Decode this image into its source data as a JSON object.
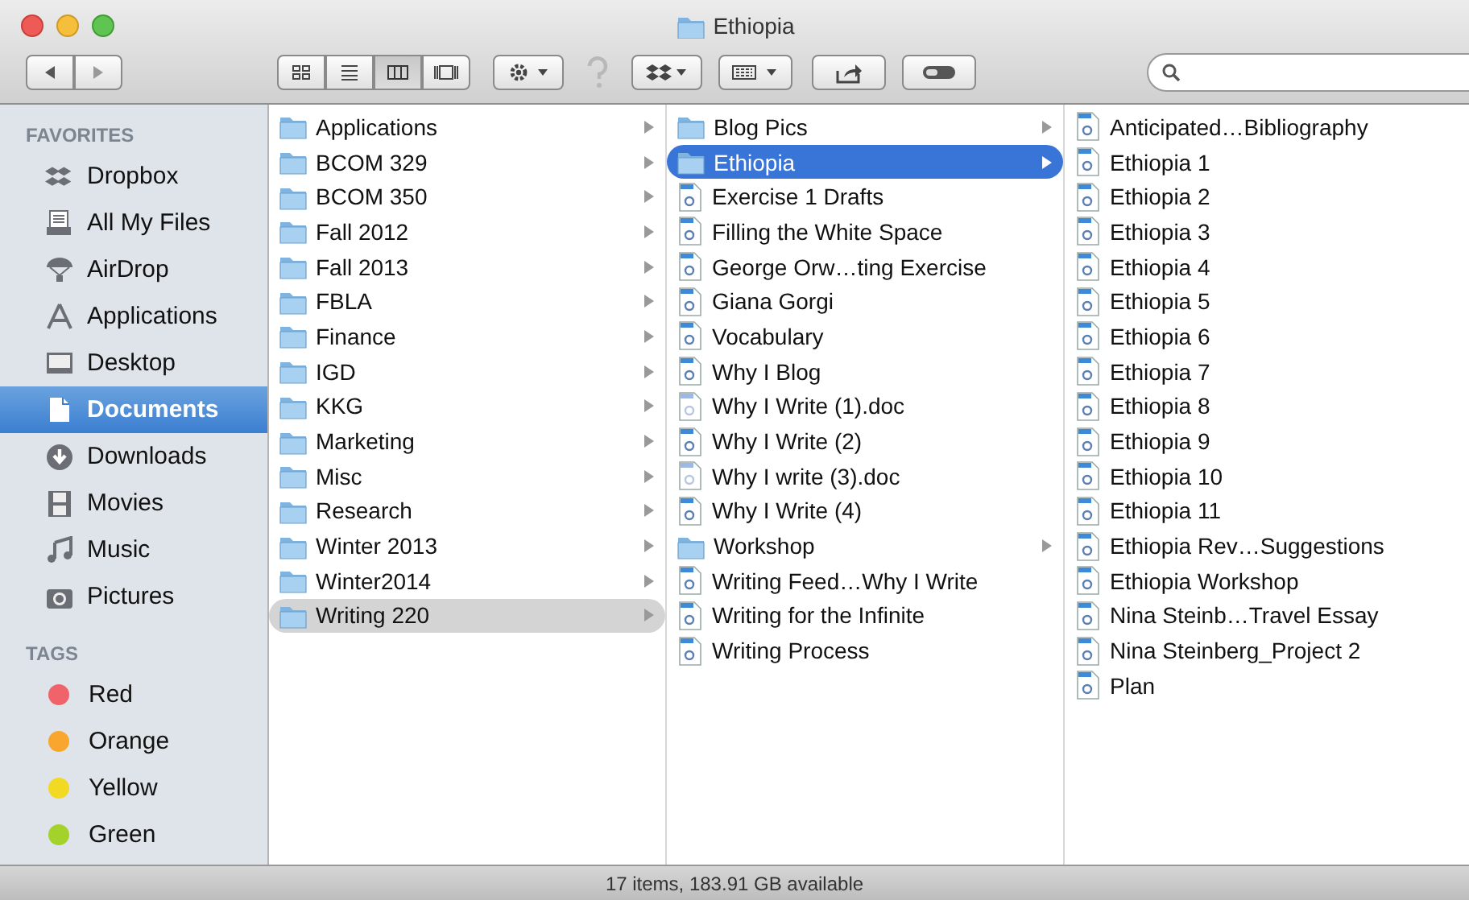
{
  "window": {
    "title": "Ethiopia"
  },
  "sidebar": {
    "sections": [
      {
        "heading": "FAVORITES",
        "items": [
          {
            "label": "Dropbox",
            "kind": "dropbox",
            "selected": false
          },
          {
            "label": "All My Files",
            "kind": "files",
            "selected": false
          },
          {
            "label": "AirDrop",
            "kind": "airdrop",
            "selected": false
          },
          {
            "label": "Applications",
            "kind": "apps",
            "selected": false
          },
          {
            "label": "Desktop",
            "kind": "desktop",
            "selected": false
          },
          {
            "label": "Documents",
            "kind": "documents",
            "selected": true
          },
          {
            "label": "Downloads",
            "kind": "downloads",
            "selected": false
          },
          {
            "label": "Movies",
            "kind": "movies",
            "selected": false
          },
          {
            "label": "Music",
            "kind": "music",
            "selected": false
          },
          {
            "label": "Pictures",
            "kind": "pictures",
            "selected": false
          }
        ]
      },
      {
        "heading": "TAGS",
        "items": [
          {
            "label": "Red",
            "kind": "tag",
            "color": "#f0636b",
            "selected": false
          },
          {
            "label": "Orange",
            "kind": "tag",
            "color": "#f9a62f",
            "selected": false
          },
          {
            "label": "Yellow",
            "kind": "tag",
            "color": "#f2d923",
            "selected": false
          },
          {
            "label": "Green",
            "kind": "tag",
            "color": "#a3d22b",
            "selected": false
          }
        ]
      }
    ]
  },
  "columns": [
    {
      "items": [
        {
          "name": "Applications",
          "kind": "folder",
          "selected": false
        },
        {
          "name": "BCOM 329",
          "kind": "folder",
          "selected": false
        },
        {
          "name": "BCOM 350",
          "kind": "folder",
          "selected": false
        },
        {
          "name": "Fall 2012",
          "kind": "folder",
          "selected": false
        },
        {
          "name": "Fall 2013",
          "kind": "folder",
          "selected": false
        },
        {
          "name": "FBLA",
          "kind": "folder",
          "selected": false
        },
        {
          "name": "Finance",
          "kind": "folder",
          "selected": false
        },
        {
          "name": "IGD",
          "kind": "folder",
          "selected": false
        },
        {
          "name": "KKG",
          "kind": "folder",
          "selected": false
        },
        {
          "name": "Marketing",
          "kind": "folder",
          "selected": false
        },
        {
          "name": "Misc",
          "kind": "folder",
          "selected": false
        },
        {
          "name": "Research",
          "kind": "folder",
          "selected": false
        },
        {
          "name": "Winter 2013",
          "kind": "folder",
          "selected": false
        },
        {
          "name": "Winter2014",
          "kind": "folder",
          "selected": false
        },
        {
          "name": "Writing 220",
          "kind": "folder",
          "selected": true,
          "focused": false
        }
      ]
    },
    {
      "items": [
        {
          "name": "Blog Pics",
          "kind": "folder",
          "selected": false
        },
        {
          "name": "Ethiopia",
          "kind": "folder",
          "selected": true,
          "focused": true
        },
        {
          "name": "Exercise 1 Drafts",
          "kind": "document",
          "selected": false
        },
        {
          "name": "Filling the White Space",
          "kind": "document",
          "selected": false
        },
        {
          "name": "George Orw…ting Exercise",
          "kind": "document",
          "selected": false
        },
        {
          "name": "Giana Gorgi",
          "kind": "document",
          "selected": false
        },
        {
          "name": "Vocabulary",
          "kind": "document",
          "selected": false
        },
        {
          "name": "Why I Blog",
          "kind": "document",
          "selected": false
        },
        {
          "name": "Why I Write (1).doc",
          "kind": "word",
          "selected": false
        },
        {
          "name": "Why I Write (2)",
          "kind": "document",
          "selected": false
        },
        {
          "name": "Why I write (3).doc",
          "kind": "word",
          "selected": false
        },
        {
          "name": "Why I Write (4)",
          "kind": "document",
          "selected": false
        },
        {
          "name": "Workshop",
          "kind": "folder",
          "selected": false
        },
        {
          "name": "Writing Feed…Why I Write",
          "kind": "document",
          "selected": false
        },
        {
          "name": "Writing for the Infinite",
          "kind": "document",
          "selected": false
        },
        {
          "name": "Writing Process",
          "kind": "document",
          "selected": false
        }
      ]
    },
    {
      "items": [
        {
          "name": "Anticipated…Bibliography",
          "kind": "document",
          "selected": false
        },
        {
          "name": "Ethiopia 1",
          "kind": "document",
          "selected": false
        },
        {
          "name": "Ethiopia 2",
          "kind": "document",
          "selected": false
        },
        {
          "name": "Ethiopia 3",
          "kind": "document",
          "selected": false
        },
        {
          "name": "Ethiopia 4",
          "kind": "document",
          "selected": false
        },
        {
          "name": "Ethiopia 5",
          "kind": "document",
          "selected": false
        },
        {
          "name": "Ethiopia 6",
          "kind": "document",
          "selected": false
        },
        {
          "name": "Ethiopia 7",
          "kind": "document",
          "selected": false
        },
        {
          "name": "Ethiopia 8",
          "kind": "document",
          "selected": false
        },
        {
          "name": "Ethiopia 9",
          "kind": "document",
          "selected": false
        },
        {
          "name": "Ethiopia 10",
          "kind": "document",
          "selected": false
        },
        {
          "name": "Ethiopia 11",
          "kind": "document",
          "selected": false
        },
        {
          "name": "Ethiopia Rev…Suggestions",
          "kind": "document",
          "selected": false
        },
        {
          "name": "Ethiopia Workshop",
          "kind": "document",
          "selected": false
        },
        {
          "name": "Nina Steinb…Travel Essay",
          "kind": "document",
          "selected": false
        },
        {
          "name": "Nina Steinberg_Project 2",
          "kind": "document",
          "selected": false
        },
        {
          "name": "Plan",
          "kind": "document",
          "selected": false
        }
      ]
    }
  ],
  "status_bar": "17 items, 183.91 GB available"
}
